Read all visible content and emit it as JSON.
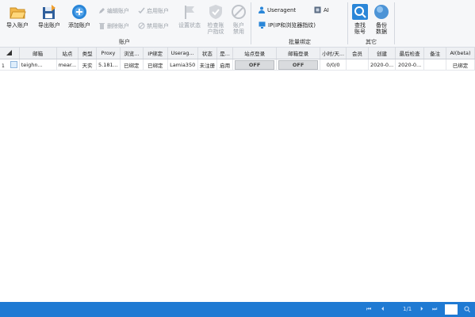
{
  "ribbon": {
    "import_label": "导入账户",
    "export_label": "导出账户",
    "add_label": "添加账户",
    "edit_label": "编辑账户",
    "enable_label": "启用账户",
    "delete_label": "删除账户",
    "disable_label": "禁用账户",
    "set_status_label": "设置状态",
    "check_fingerprint_label": "检查账户指纹",
    "disable_account_big_label": "账户禁用",
    "account_group_title": "账户",
    "useragent_label": "Useragent",
    "ai_label": "AI",
    "ip_bind_label": "IP(IP和浏览器指纹)",
    "batch_bind_title": "批量绑定",
    "find_label": "查找账号",
    "backup_label": "备份数据",
    "other_group_title": "其它"
  },
  "table": {
    "columns": [
      "",
      "邮箱",
      "站点",
      "类型",
      "Proxy",
      "浏览...",
      "IP绑定",
      "Userag...",
      "状态",
      "是...",
      "站点登录",
      "邮箱登录",
      "小时/天...",
      "会员",
      "创建",
      "最后检查",
      "备注",
      "AI(beta)"
    ],
    "rows": [
      {
        "num": "1",
        "email": "teighn...",
        "site": "mear...",
        "type": "天实",
        "proxy": "5.181...",
        "browser": "已绑定",
        "ip_bind": "已绑定",
        "useragent": "Lamia350",
        "status": "未注册",
        "enabled": "启用",
        "site_login": "OFF",
        "mail_login": "OFF",
        "per_hour": "0/0/0",
        "member": "",
        "created": "2020-0...",
        "last_check": "2020-0...",
        "note": "",
        "ai": "已绑定"
      }
    ]
  },
  "pager": {
    "first": "⏮",
    "prev": "⏴",
    "page_text": "1/1",
    "next": "⏵",
    "last": "⏭"
  },
  "colors": {
    "statusbar": "#1f7ad3",
    "ribbon_bg": "#f6f7f9",
    "icon_blue": "#2a86d8",
    "icon_orange": "#f0a030"
  }
}
